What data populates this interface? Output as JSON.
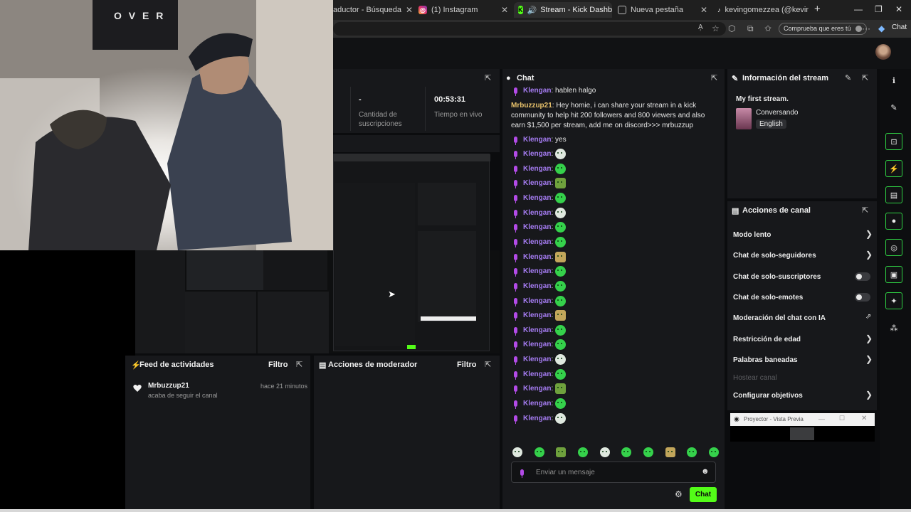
{
  "browser": {
    "tabs": [
      {
        "label": "aductor - Búsqueda"
      },
      {
        "label": "(1) Instagram"
      },
      {
        "label": "Stream - Kick Dashboard"
      },
      {
        "label": "Nueva pestaña"
      },
      {
        "label": "kevingomezzea (@kevingon"
      }
    ],
    "compr_label": "Comprueba que eres tú",
    "chat_label": "Chat"
  },
  "webcam": {
    "poster_text": "O V E R"
  },
  "stats": [
    {
      "value": "-",
      "label": "Cantidad de suscripciones"
    },
    {
      "value": "00:53:31",
      "label": "Tiempo en vivo"
    }
  ],
  "chat": {
    "title": "Chat",
    "messages": [
      {
        "user": "Klengan",
        "text": "hablen halgo"
      },
      {
        "user": "Mrbuzzup21",
        "text": "Hey homie, i can share your stream in a kick community to help hit 200 followers and 800 viewers and also earn $1,500 per stream, add me on discord>>> mrbuzzup"
      },
      {
        "user": "Klengan",
        "text": "yes"
      }
    ],
    "emote_user": "Klengan",
    "input_placeholder": "Enviar un mensaje",
    "send_label": "Chat"
  },
  "stream_info": {
    "title": "Información del stream",
    "stream_title": "My first stream.",
    "category": "Conversando",
    "language": "English"
  },
  "channel_actions": {
    "title": "Acciones de canal",
    "items": [
      {
        "label": "Modo lento"
      },
      {
        "label": "Chat de solo-seguidores"
      },
      {
        "label": "Chat de solo-suscriptores"
      },
      {
        "label": "Chat de solo-emotes"
      },
      {
        "label": "Moderación del chat con IA"
      },
      {
        "label": "Restricción de edad"
      },
      {
        "label": "Palabras baneadas"
      },
      {
        "label": "Hostear canal"
      },
      {
        "label": "Configurar objetivos"
      }
    ]
  },
  "projector": {
    "title": "Proyector - Vista Previa"
  },
  "feed": {
    "title": "Feed de actividades",
    "filter": "Filtro",
    "entry_user": "Mrbuzzup21",
    "entry_text": "acaba de seguir el canal",
    "entry_time": "hace 21 minutos"
  },
  "mod_actions": {
    "title": "Acciones de moderador",
    "filter": "Filtro"
  },
  "colors": {
    "accent": "#53fc18",
    "username": "#a57cf2",
    "highlight_user": "#e8c26b"
  }
}
